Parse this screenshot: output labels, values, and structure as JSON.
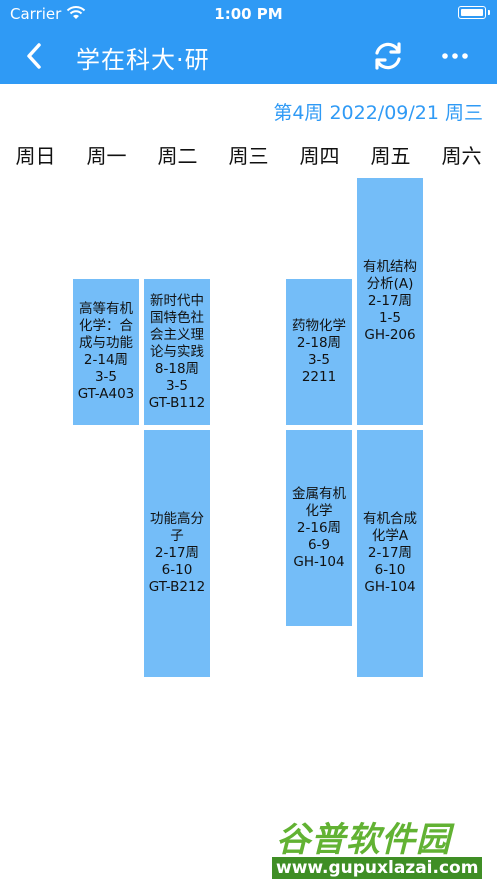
{
  "status_bar": {
    "carrier": "Carrier",
    "time": "1:00 PM"
  },
  "nav": {
    "title": "学在科大·研",
    "back_icon": "chevron-left-icon",
    "refresh_icon": "refresh-icon",
    "more_icon": "more-horizontal-icon"
  },
  "colors": {
    "header": "#2f9af5",
    "course_block": "#74bdf8",
    "accent_text": "#2f9af5"
  },
  "week_info": "第4周 2022/09/21 周三",
  "days": [
    "周日",
    "周一",
    "周二",
    "周三",
    "周四",
    "周五",
    "周六"
  ],
  "courses": [
    {
      "day": "周一",
      "text": "高等有机化学：合成与功能\n2-14周\n3-5\nGT-A403"
    },
    {
      "day": "周二",
      "text": "新时代中国特色社会主义理论与实践\n8-18周\n3-5\nGT-B112"
    },
    {
      "day": "周二",
      "text": "功能高分子\n2-17周\n6-10\nGT-B212"
    },
    {
      "day": "周四",
      "text": "药物化学\n2-18周\n3-5\n2211"
    },
    {
      "day": "周四",
      "text": "金属有机化学\n2-16周\n6-9\nGH-104"
    },
    {
      "day": "周五",
      "text": "有机结构分析(A)\n2-17周\n1-5\nGH-206"
    },
    {
      "day": "周五",
      "text": "有机合成化学A\n2-17周\n6-10\nGH-104"
    }
  ],
  "watermark": {
    "text": "谷普软件园",
    "url": "www.gupuxlazai.com"
  }
}
